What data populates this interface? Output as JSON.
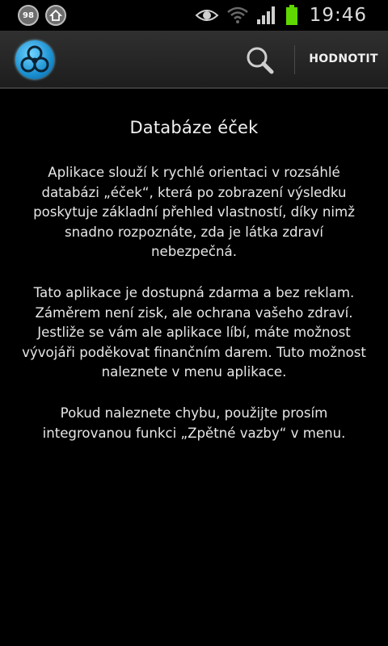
{
  "status_bar": {
    "notification_badge": "98",
    "time": "19:46"
  },
  "action_bar": {
    "logo_icon": "biohazard-icon",
    "search_icon": "search-icon",
    "rate_label": "HODNOTIT"
  },
  "content": {
    "title": "Databáze éček",
    "paragraph_1": [
      "Aplikace slouží k rychlé orientaci v rozsáhlé",
      "databázi „éček“, která po zobrazení výsledku",
      "poskytuje základní přehled vlastností, díky nimž",
      "snadno rozpoznáte, zda je látka zdraví",
      "nebezpečná."
    ],
    "paragraph_2": [
      "Tato aplikace je dostupná zdarma a bez reklam.",
      "Záměrem není zisk, ale ochrana vašeho zdraví.",
      "Jestliže se vám ale aplikace líbí, máte možnost",
      "vývojáři poděkovat finančním darem. Tuto možnost",
      "naleznete v menu aplikace."
    ],
    "paragraph_3": [
      "Pokud naleznete chybu, použijte prosím",
      "integrovanou funkci „Zpětné vazby“ v menu."
    ]
  },
  "colors": {
    "background": "#000000",
    "action_bar": "#2a2a2a",
    "logo_accent": "#1a8fd0",
    "battery": "#5fd700"
  }
}
